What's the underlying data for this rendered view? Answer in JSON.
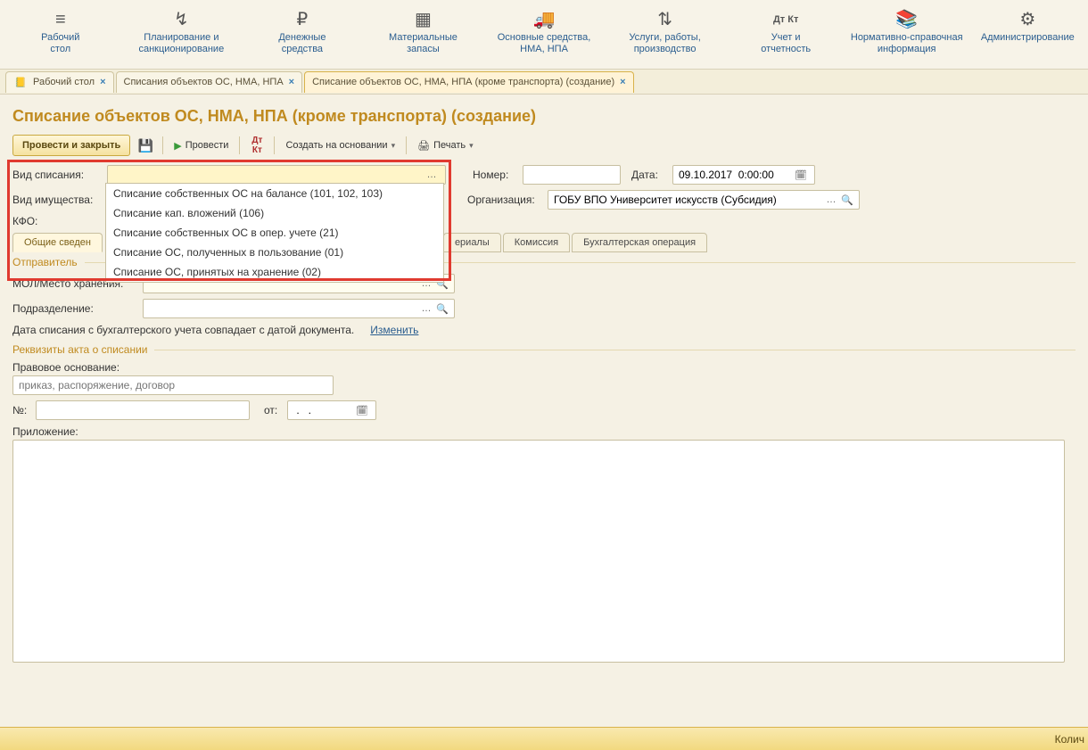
{
  "topnav": [
    {
      "icon": "≡",
      "label": "Рабочий\nстол"
    },
    {
      "icon": "↯",
      "label": "Планирование и\nсанкционирование"
    },
    {
      "icon": "₽",
      "label": "Денежные\nсредства"
    },
    {
      "icon": "▦",
      "label": "Материальные\nзапасы"
    },
    {
      "icon": "🚚",
      "label": "Основные средства,\nНМА, НПА"
    },
    {
      "icon": "⇅",
      "label": "Услуги, работы,\nпроизводство"
    },
    {
      "icon": "Дт Кт",
      "label": "Учет и\nотчетность"
    },
    {
      "icon": "📚",
      "label": "Нормативно-справочная\nинформация"
    },
    {
      "icon": "⚙",
      "label": "Администрирование"
    }
  ],
  "tabs": [
    {
      "label": "Рабочий стол"
    },
    {
      "label": "Списания объектов ОС, НМА, НПА"
    },
    {
      "label": "Списание объектов ОС, НМА, НПА (кроме транспорта) (создание)"
    }
  ],
  "title": "Списание объектов ОС, НМА, НПА (кроме транспорта) (создание)",
  "toolbar": {
    "post_close": "Провести и закрыть",
    "post": "Провести",
    "create_based": "Создать на основании",
    "print": "Печать"
  },
  "labels": {
    "vid_spisaniya": "Вид списания:",
    "vid_imushchestva": "Вид имущества:",
    "kfo": "КФО:",
    "nomer": "Номер:",
    "data": "Дата:",
    "org": "Организация:",
    "otpravitel": "Отправитель",
    "mol": "МОЛ/Место хранения:",
    "podrazdelenie": "Подразделение:",
    "date_note": "Дата списания с бухгалтерского учета совпадает с датой документа.",
    "izmenit": "Изменить",
    "rekvizity": "Реквизиты акта о списании",
    "pravo": "Правовое основание:",
    "pravo_placeholder": "приказ, распоряжение, договор",
    "num": "№:",
    "ot": "от:",
    "ot_value": " .   .",
    "prilozhenie": "Приложение:"
  },
  "values": {
    "date": "09.10.2017  0:00:00",
    "org": "ГОБУ ВПО Университет искусств (Субсидия)"
  },
  "dropdown": [
    "Списание собственных ОС на балансе (101, 102, 103)",
    "Списание кап. вложений (106)",
    "Списание собственных ОС в опер. учете (21)",
    "Списание ОС, полученных в пользование (01)",
    "Списание ОС, принятых на хранение (02)"
  ],
  "inner_tabs": [
    "Общие сведен",
    "ериалы",
    "Комиссия",
    "Бухгалтерская операция"
  ],
  "footer": "Колич"
}
